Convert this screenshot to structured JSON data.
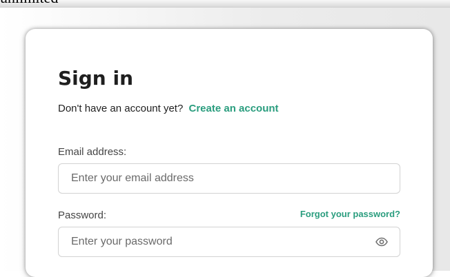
{
  "background": {
    "top_text": "unlimited"
  },
  "signin": {
    "title": "Sign in",
    "no_account_text": "Don't have an account yet?",
    "create_account_label": "Create an account",
    "email_label": "Email address:",
    "email_placeholder": "Enter your email address",
    "password_label": "Password:",
    "forgot_password_label": "Forgot your password?",
    "password_placeholder": "Enter your password",
    "show_password_icon": "eye-icon"
  },
  "colors": {
    "accent": "#2a9d7e",
    "text": "#1f1f1f",
    "label": "#444444",
    "input_border": "#d2d2d2"
  }
}
